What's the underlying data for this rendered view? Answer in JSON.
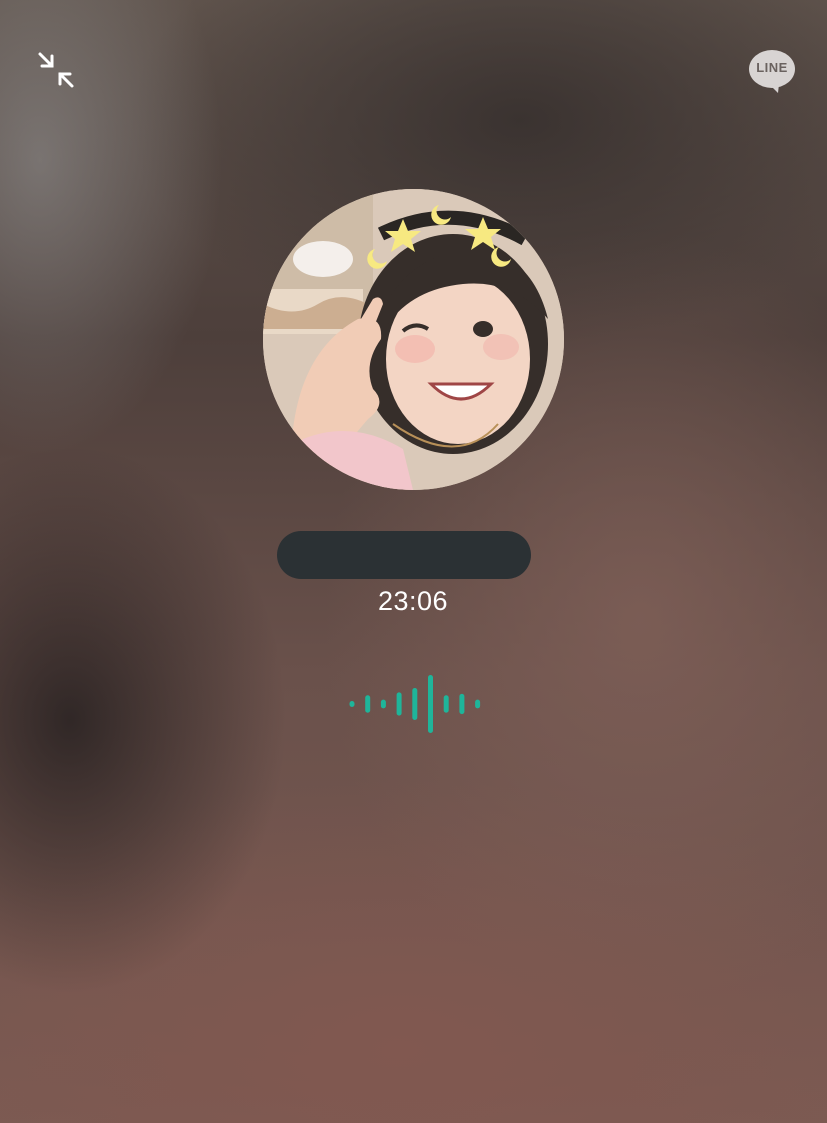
{
  "app": {
    "brand_label": "LINE"
  },
  "call": {
    "contact_name": "",
    "elapsed_time": "23:06"
  },
  "controls": {
    "minimize_icon": "minimize-arrows-icon"
  },
  "colors": {
    "waveform_accent": "#1fb59a",
    "name_bar": "#2b3134",
    "timer_text": "#ffffff"
  },
  "waveform": {
    "levels": [
      0.1,
      0.3,
      0.15,
      0.4,
      0.55,
      1.0,
      0.3,
      0.35,
      0.15,
      0.1
    ]
  }
}
